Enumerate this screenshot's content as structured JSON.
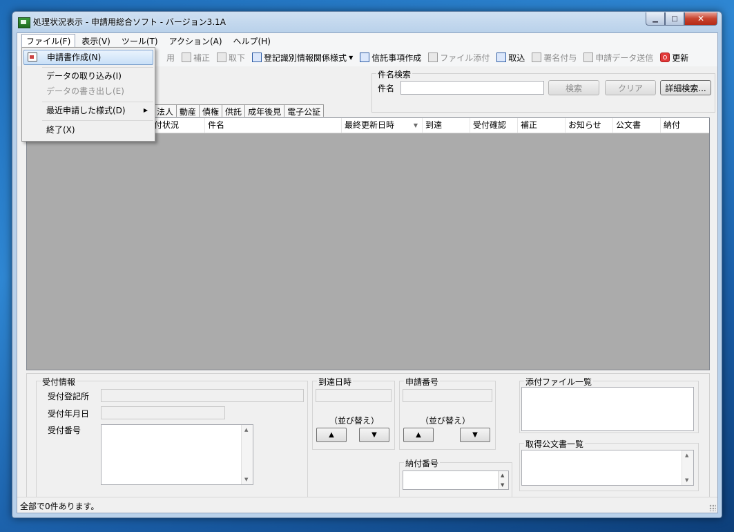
{
  "window": {
    "title": "処理状況表示 - 申請用総合ソフト - バージョン3.1A",
    "minimize": "▁",
    "maximize": "□",
    "close": "✕"
  },
  "menubar": [
    {
      "label": "ファイル(F)"
    },
    {
      "label": "表示(V)"
    },
    {
      "label": "ツール(T)"
    },
    {
      "label": "アクション(A)"
    },
    {
      "label": "ヘルプ(H)"
    }
  ],
  "toolbar": {
    "partial": "用",
    "hosei": "補正",
    "torisage": "取下",
    "touki": "登記識別情報関係様式",
    "shintaku": "信託事項作成",
    "file_attach": "ファイル添付",
    "torikomi": "取込",
    "shomei": "署名付与",
    "soushin": "申請データ送信",
    "koushin": "更新"
  },
  "search": {
    "legend": "件名検索",
    "label": "件名",
    "value": "",
    "search_btn": "検索",
    "clear_btn": "クリア",
    "detail_btn": "詳細検索..."
  },
  "tabs": [
    "法人",
    "動産",
    "債権",
    "供託",
    "成年後見",
    "電子公証"
  ],
  "list_columns": [
    "付状況",
    "件名",
    "最終更新日時",
    "到達",
    "受付確認",
    "補正",
    "お知らせ",
    "公文書",
    "納付"
  ],
  "receipt": {
    "legend": "受付情報",
    "office_label": "受付登記所",
    "date_label": "受付年月日",
    "number_label": "受付番号"
  },
  "arrival": {
    "legend": "到達日時",
    "sort_label": "（並び替え）",
    "up": "▲",
    "down": "▼"
  },
  "app_number": {
    "legend": "申請番号",
    "sort_label": "（並び替え）",
    "up": "▲",
    "down": "▼"
  },
  "payment": {
    "legend": "納付番号"
  },
  "attachments": {
    "legend": "添付ファイル一覧"
  },
  "documents": {
    "legend": "取得公文書一覧"
  },
  "status": "全部で0件あります。",
  "file_menu": {
    "items": [
      {
        "label": "申請書作成(N)"
      },
      {
        "label": "データの取り込み(I)"
      },
      {
        "label": "データの書き出し(E)"
      },
      {
        "label": "最近申請した様式(D)"
      },
      {
        "label": "終了(X)"
      }
    ]
  }
}
